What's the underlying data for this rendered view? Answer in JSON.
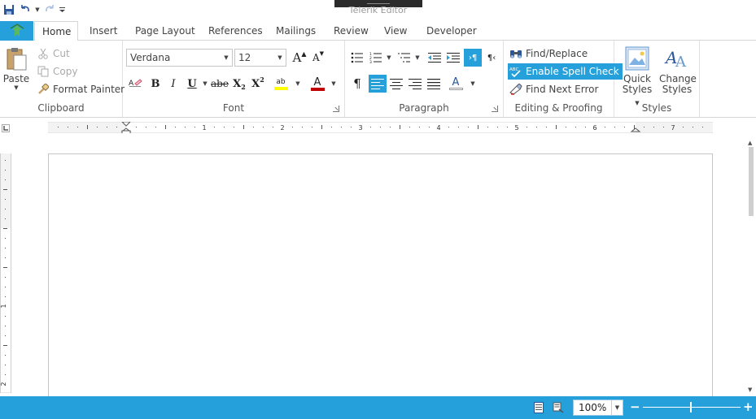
{
  "window": {
    "title": "Telerik Editor"
  },
  "tabs": [
    {
      "label": "Home",
      "active": true
    },
    {
      "label": "Insert"
    },
    {
      "label": "Page Layout"
    },
    {
      "label": "References"
    },
    {
      "label": "Mailings"
    },
    {
      "label": "Review"
    },
    {
      "label": "View"
    },
    {
      "label": "Developer"
    }
  ],
  "clipboard": {
    "label": "Clipboard",
    "paste": "Paste",
    "cut": "Cut",
    "copy": "Copy",
    "format_painter": "Format Painter"
  },
  "font": {
    "label": "Font",
    "family": "Verdana",
    "size": "12",
    "bold": "B",
    "italic": "I",
    "underline": "U",
    "strike": "abe",
    "subscript": "X",
    "superscript": "X",
    "grow": "A",
    "shrink": "A",
    "highlight_glyph": "ab",
    "color_glyph": "A"
  },
  "paragraph": {
    "label": "Paragraph",
    "pilcrow": "¶"
  },
  "editing": {
    "label": "Editing & Proofing",
    "find_replace": "Find/Replace",
    "spell_check": "Enable Spell Check",
    "find_next_error": "Find Next Error"
  },
  "styles": {
    "label": "Styles",
    "quick_styles_1": "Quick",
    "quick_styles_2": "Styles",
    "change_styles_1": "Change",
    "change_styles_2": "Styles"
  },
  "ruler": {
    "numbers": [
      "1",
      "2",
      "3",
      "4",
      "5",
      "6",
      "7"
    ],
    "vnumbers": [
      "1",
      "2"
    ]
  },
  "status": {
    "zoom": "100%",
    "minus": "−",
    "plus": "+"
  },
  "colors": {
    "accent": "#26a0da",
    "highlight": "#ffff00",
    "font_color": "#c00000"
  }
}
